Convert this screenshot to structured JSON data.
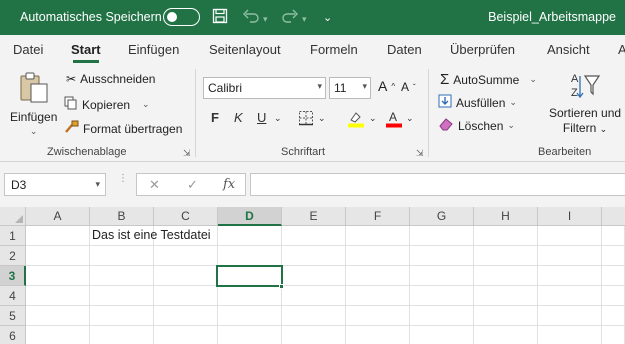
{
  "titlebar": {
    "autosave_label": "Automatisches Speichern",
    "filename": "Beispiel_Arbeitsmappe",
    "icons": [
      "save-icon",
      "undo-icon",
      "redo-icon",
      "customize-icon"
    ]
  },
  "tabs": [
    "Datei",
    "Start",
    "Einfügen",
    "Seitenlayout",
    "Formeln",
    "Daten",
    "Überprüfen",
    "Ansicht",
    "A"
  ],
  "active_tab": "Start",
  "ribbon": {
    "clipboard": {
      "paste_label": "Einfügen",
      "cut_label": "Ausschneiden",
      "copy_label": "Kopieren",
      "format_painter_label": "Format übertragen",
      "group_label": "Zwischenablage"
    },
    "font": {
      "font_name": "Calibri",
      "font_size": "11",
      "bold": "F",
      "italic": "K",
      "underline": "U",
      "group_label": "Schriftart",
      "highlight_color": "#ffff00",
      "font_color": "#ff0000"
    },
    "editing": {
      "autosum_label": "AutoSumme",
      "fill_label": "Ausfüllen",
      "clear_label": "Löschen",
      "sort_label_1": "Sortieren und",
      "sort_label_2": "Filtern",
      "group_label": "Bearbeiten"
    }
  },
  "formula_bar": {
    "name_box": "D3",
    "cancel": "✕",
    "enter": "✓",
    "fx": "fx",
    "formula": ""
  },
  "grid": {
    "columns": [
      "A",
      "B",
      "C",
      "D",
      "E",
      "F",
      "G",
      "H",
      "I"
    ],
    "rows": [
      "1",
      "2",
      "3",
      "4",
      "5",
      "6"
    ],
    "selected_cell": "D3",
    "cells": {
      "B1": "Das ist eine Testdatei"
    }
  },
  "colors": {
    "accent": "#217346"
  }
}
